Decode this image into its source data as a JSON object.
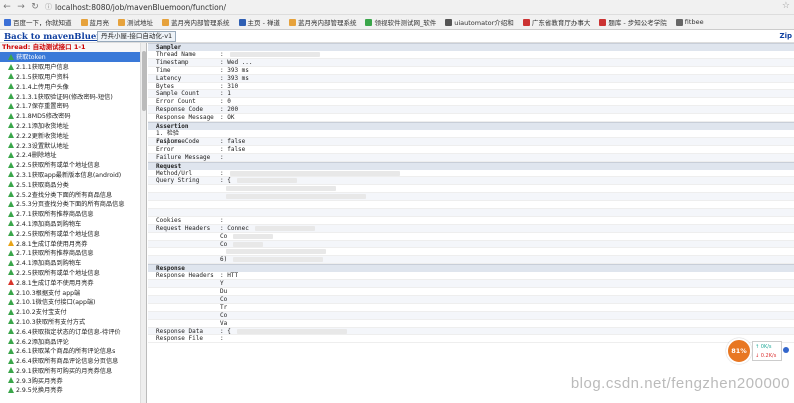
{
  "browser": {
    "url": "localhost:8080/job/mavenBluemoon/function/"
  },
  "bookmarks": [
    {
      "label": "百度一下，你就知道",
      "color": "#3b6fd6"
    },
    {
      "label": "蓝月亮",
      "color": "#e6a23c"
    },
    {
      "label": "测试地址",
      "color": "#e6a23c"
    },
    {
      "label": "蓝月亮内部管理系统",
      "color": "#e6a23c"
    },
    {
      "label": "主页 - 禅道",
      "color": "#2f5fb3"
    },
    {
      "label": "蓝月亮内部管理系统",
      "color": "#e6a23c"
    },
    {
      "label": "领视软件测试网_软件",
      "color": "#3aa64a"
    },
    {
      "label": "uiautomator介绍和",
      "color": "#555"
    },
    {
      "label": "广东省教育厅办事大",
      "color": "#c33"
    },
    {
      "label": "题库 - 步知公考学院",
      "color": "#c33"
    },
    {
      "label": "fitbee",
      "color": "#666"
    }
  ],
  "page": {
    "back_link": "Back to mavenBluemoon",
    "tab1": "丹兵小屋-接口自动化-v1",
    "zip": "Zip"
  },
  "sidebar": {
    "thread": "Thread: 自动测试接口 1-1",
    "items": [
      {
        "label": "获取token",
        "s": "ok",
        "sel": true
      },
      {
        "label": "2.1.1获取用户信息",
        "s": "ok"
      },
      {
        "label": "2.1.5获取用户资料",
        "s": "ok"
      },
      {
        "label": "2.1.4上传用户头像",
        "s": "ok"
      },
      {
        "label": "2.1.3.1获取验证码(修改密码-短信)",
        "s": "ok"
      },
      {
        "label": "2.1.7保存重置密码",
        "s": "ok"
      },
      {
        "label": "2.1.8MD5修改密码",
        "s": "ok"
      },
      {
        "label": "2.2.1添加收货地址",
        "s": "ok"
      },
      {
        "label": "2.2.2更新收货地址",
        "s": "ok"
      },
      {
        "label": "2.2.3设置默认地址",
        "s": "ok"
      },
      {
        "label": "2.2.4删除地址",
        "s": "ok"
      },
      {
        "label": "2.2.5获取所有或单个地址信息",
        "s": "ok"
      },
      {
        "label": "2.3.1获取app最新版本信息(android)",
        "s": "ok"
      },
      {
        "label": "2.5.1获取商品分类",
        "s": "ok"
      },
      {
        "label": "2.5.2查找分类下面的所有商品信息",
        "s": "ok"
      },
      {
        "label": "2.5.3分页查找分类下面的所有商品信息",
        "s": "ok"
      },
      {
        "label": "2.7.1获取所有推荐商品信息",
        "s": "ok"
      },
      {
        "label": "2.4.1添加商品到购物车",
        "s": "ok"
      },
      {
        "label": "2.2.5获取所有或单个地址信息",
        "s": "ok"
      },
      {
        "label": "2.8.1生成订单使用月亮券",
        "s": "warn"
      },
      {
        "label": "2.7.1获取所有推荐商品信息",
        "s": "ok"
      },
      {
        "label": "2.4.1添加商品到购物车",
        "s": "ok"
      },
      {
        "label": "2.2.5获取所有或单个地址信息",
        "s": "ok"
      },
      {
        "label": "2.8.1生成订单不使用月亮券",
        "s": "err"
      },
      {
        "label": "2.10.3根据支付 app端",
        "s": "ok"
      },
      {
        "label": "2.10.1微信支付接口(app端)",
        "s": "ok"
      },
      {
        "label": "2.10.2支付宝支付",
        "s": "ok"
      },
      {
        "label": "2.10.3获取所有支付方式",
        "s": "ok"
      },
      {
        "label": "2.6.4获取指定状态的订单信息-待评价",
        "s": "ok"
      },
      {
        "label": "2.6.2添加商品评论",
        "s": "ok"
      },
      {
        "label": "2.6.1获取某个商品的所有评论信息s",
        "s": "ok"
      },
      {
        "label": "2.6.4获取所有商品评论信息分页信息",
        "s": "ok"
      },
      {
        "label": "2.9.1获取所有可购买的月亮券信息",
        "s": "ok"
      },
      {
        "label": "2.9.3购买月亮券",
        "s": "ok"
      },
      {
        "label": "2.9.5兑换月亮券",
        "s": "ok"
      }
    ]
  },
  "main": {
    "sampler": {
      "title": "Sampler",
      "rows": [
        {
          "k": "Thread Name",
          "v": ":"
        },
        {
          "k": "Timestamp",
          "v": ": Wed ..."
        },
        {
          "k": "Time",
          "v": ": 393 ms"
        },
        {
          "k": "Latency",
          "v": ": 393 ms"
        },
        {
          "k": "Bytes",
          "v": ": 310"
        },
        {
          "k": "Sample Count",
          "v": ": 1"
        },
        {
          "k": "Error Count",
          "v": ": 0"
        },
        {
          "k": "Response Code",
          "v": ": 200"
        },
        {
          "k": "Response Message",
          "v": ": OK"
        }
      ]
    },
    "assertion": {
      "title": "Assertion",
      "rows": [
        {
          "k": "1. 检验responseCode",
          "v": ""
        },
        {
          "k": "Failure",
          "v": ": false"
        },
        {
          "k": "Error",
          "v": ": false"
        },
        {
          "k": "Failure Message",
          "v": ":"
        }
      ]
    },
    "request": {
      "title": "Request",
      "rows": [
        {
          "k": "Method/Url",
          "v": ":"
        },
        {
          "k": "Query String",
          "v": ": {"
        },
        {
          "k": "",
          "v": ""
        },
        {
          "k": "",
          "v": ""
        },
        {
          "k": "",
          "v": ""
        },
        {
          "k": "",
          "v": ""
        },
        {
          "k": "Cookies",
          "v": ":"
        },
        {
          "k": "Request Headers",
          "v": ": Connec"
        },
        {
          "k": "",
          "v": "  Co"
        },
        {
          "k": "",
          "v": "  Co"
        },
        {
          "k": "",
          "v": ""
        },
        {
          "k": "",
          "v": "  6)"
        }
      ]
    },
    "response": {
      "title": "Response",
      "rows": [
        {
          "k": "Response Headers",
          "v": ": HTT"
        },
        {
          "k": "",
          "v": "  Y"
        },
        {
          "k": "",
          "v": "  Du"
        },
        {
          "k": "",
          "v": "  Co"
        },
        {
          "k": "",
          "v": "  Tr"
        },
        {
          "k": "",
          "v": "  Co"
        },
        {
          "k": "",
          "v": "  Va"
        },
        {
          "k": "Response Data",
          "v": ": {"
        },
        {
          "k": "Response File",
          "v": ":"
        }
      ]
    }
  },
  "overlay": {
    "watermark": "blog.csdn.net/fengzhen200000",
    "gauge": "81%",
    "up": "0K/s",
    "down": "0.2K/s"
  }
}
